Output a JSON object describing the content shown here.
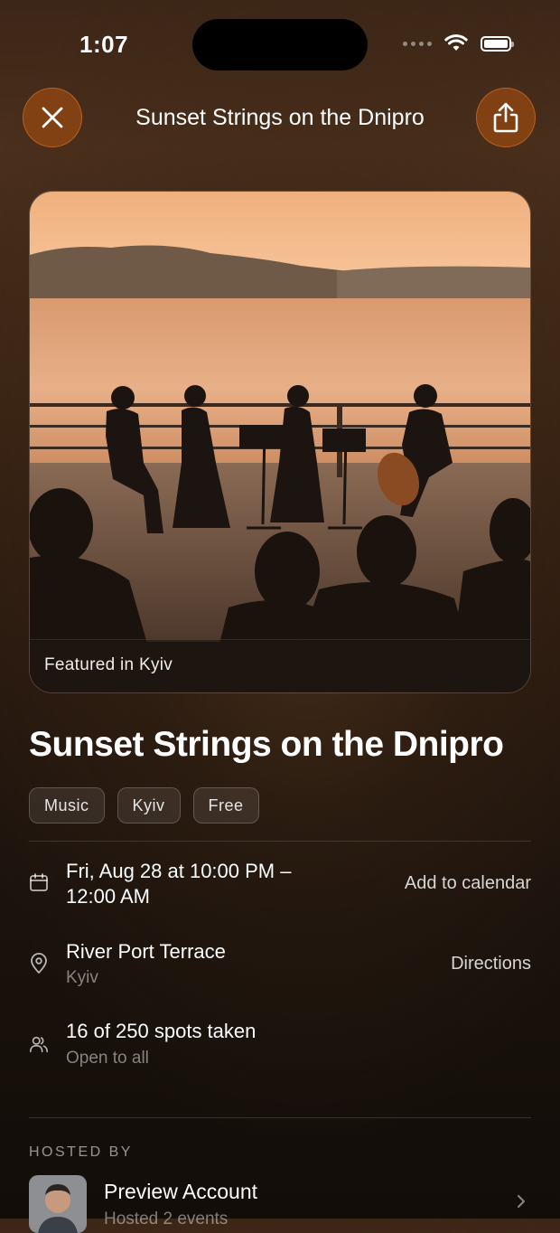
{
  "status_bar": {
    "time": "1:07"
  },
  "nav": {
    "title": "Sunset Strings on the Dnipro"
  },
  "hero": {
    "caption": "Featured in Kyiv"
  },
  "event": {
    "title": "Sunset Strings on the Dnipro",
    "tags": [
      "Music",
      "Kyiv",
      "Free"
    ]
  },
  "details": {
    "datetime_line1": "Fri, Aug 28 at 10:00 PM –",
    "datetime_line2": "12:00 AM",
    "calendar_action": "Add to calendar",
    "venue": "River Port Terrace",
    "city": "Kyiv",
    "directions_action": "Directions",
    "attendance": "16 of 250 spots taken",
    "access": "Open to all"
  },
  "host": {
    "section_label": "HOSTED BY",
    "name": "Preview Account",
    "subtitle": "Hosted 2 events"
  }
}
